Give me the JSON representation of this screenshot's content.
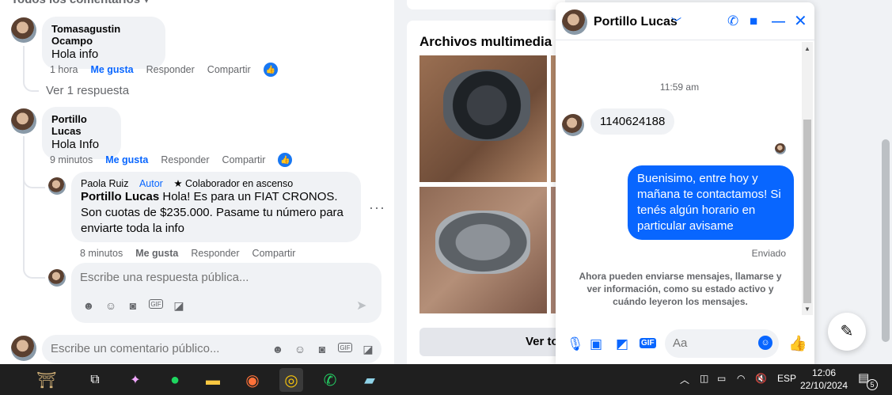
{
  "comments_header": "Todos los comentarios",
  "comments": {
    "c1": {
      "author": "Tomasagustin Ocampo",
      "text": "Hola info",
      "time": "1 hora",
      "like": "Me gusta",
      "reply": "Responder",
      "share": "Compartir"
    },
    "view_replies": "Ver 1 respuesta",
    "c2": {
      "author": "Portillo Lucas",
      "text": "Hola Info",
      "time": "9 minutos",
      "like": "Me gusta",
      "reply": "Responder",
      "share": "Compartir"
    },
    "c3": {
      "author": "Paola Ruiz",
      "author_tag": "Autor",
      "badge": "Colaborador en ascenso",
      "mention": "Portillo Lucas",
      "text": " Hola! Es para un FIAT CRONOS. Son cuotas de $235.000. Pasame tu número para enviarte toda la info",
      "time": "8 minutos",
      "like": "Me gusta",
      "reply": "Responder",
      "share": "Compartir"
    }
  },
  "reply_box": {
    "placeholder": "Escribe una respuesta pública..."
  },
  "comment_box": {
    "placeholder": "Escribe un comentario público..."
  },
  "media": {
    "title": "Archivos multimedia re",
    "button": "Ver to"
  },
  "chat": {
    "contact": "Portillo Lucas",
    "time": "11:59 am",
    "incoming": "1140624188",
    "outgoing": "Buenisimo, entre hoy y mañana te contactamos! Si tenés algún horario en particular avisame",
    "status": "Enviado",
    "notice": "Ahora pueden enviarse mensajes, llamarse y ver información, como su estado activo y cuándo leyeron los mensajes.",
    "input_placeholder": "Aa"
  },
  "taskbar": {
    "language": "ESP",
    "time": "12:06",
    "date": "22/10/2024",
    "notifications": "5"
  },
  "colors": {
    "accent": "#0866ff",
    "brand": "#1877f2",
    "taskbar": "#1f1f1f"
  }
}
